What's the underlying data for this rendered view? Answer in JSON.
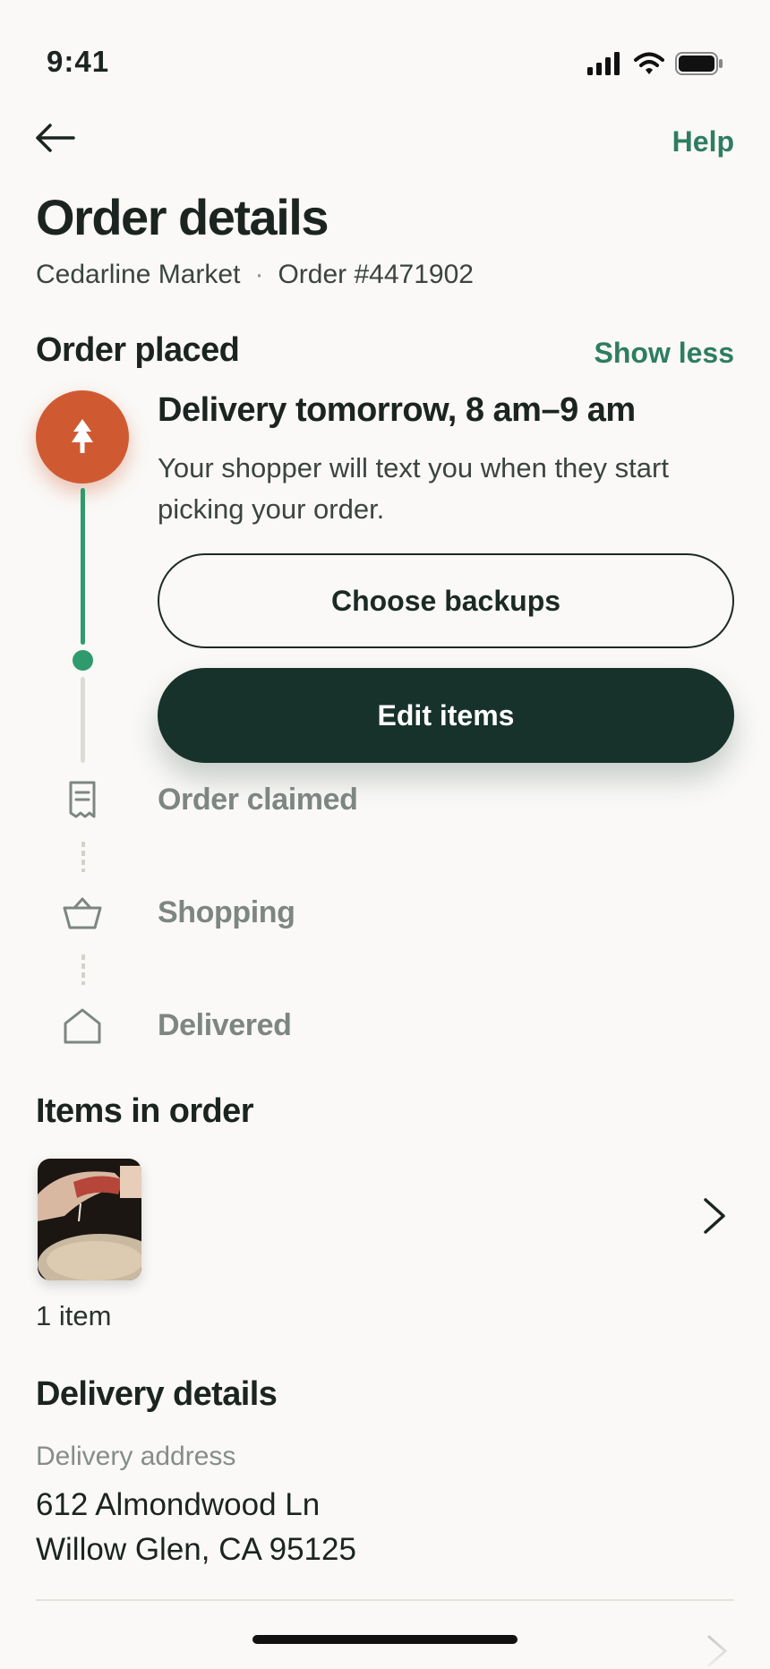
{
  "status_bar": {
    "time": "9:41"
  },
  "nav": {
    "help_label": "Help"
  },
  "header": {
    "title": "Order details",
    "store": "Cedarline Market",
    "separator": "·",
    "order_number": "Order #4471902"
  },
  "progress": {
    "section_title": "Order placed",
    "toggle_label": "Show less",
    "current": {
      "title": "Delivery tomorrow, 8 am–9 am",
      "description": "Your shopper will text you when they start picking your order."
    },
    "buttons": {
      "backups": "Choose backups",
      "edit": "Edit items"
    },
    "steps": [
      {
        "label": "Order claimed",
        "icon": "receipt-icon"
      },
      {
        "label": "Shopping",
        "icon": "basket-icon"
      },
      {
        "label": "Delivered",
        "icon": "house-icon"
      }
    ]
  },
  "items": {
    "section_title": "Items in order",
    "count_label": "1 item"
  },
  "delivery": {
    "section_title": "Delivery details",
    "address_label": "Delivery address",
    "address_line1": "612 Almondwood Ln",
    "address_line2": "Willow Glen, CA 95125"
  },
  "colors": {
    "accent_green": "#2e7d63",
    "timeline_green": "#2e9a6e",
    "primary_button": "#17322a",
    "badge_orange": "#cf5a32"
  }
}
